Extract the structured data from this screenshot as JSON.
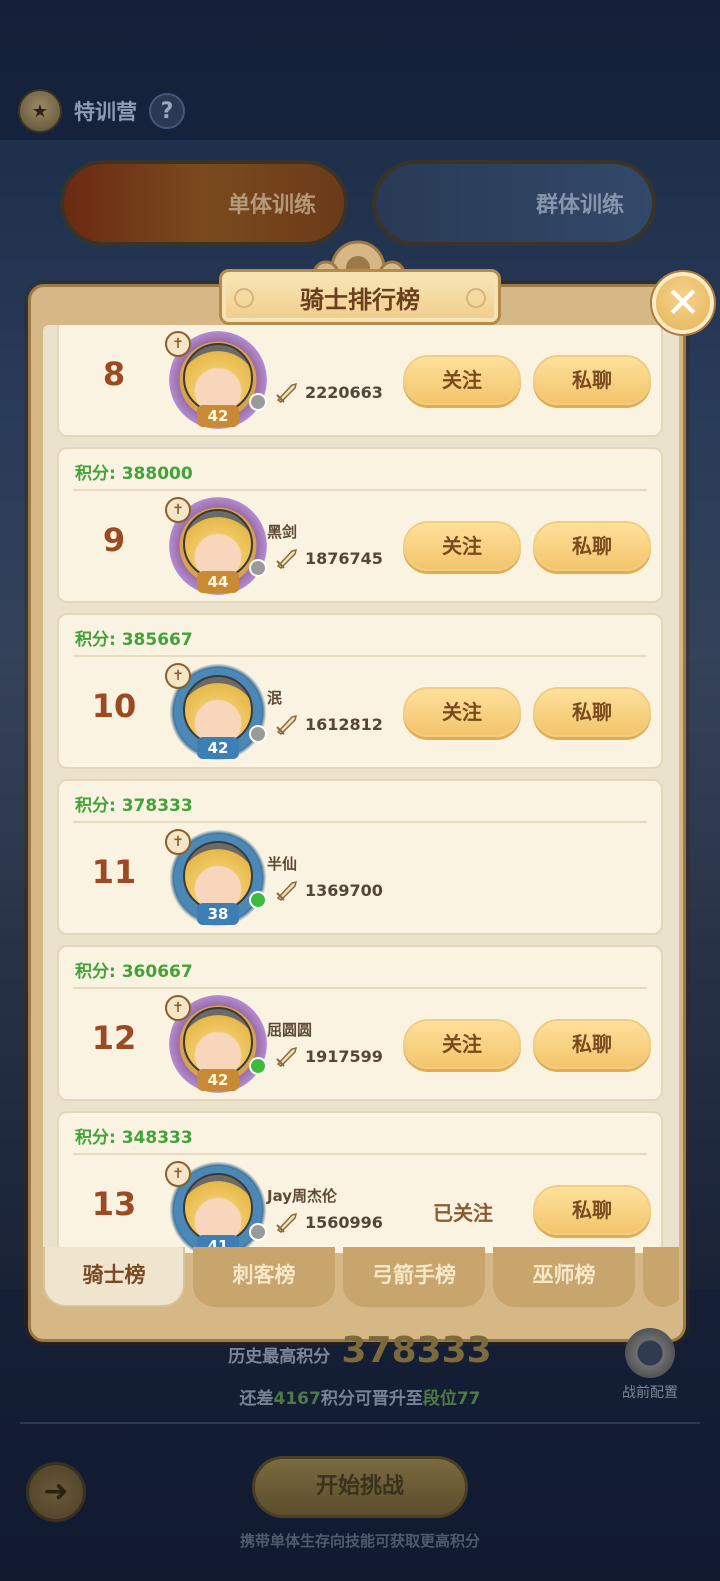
{
  "header": {
    "title": "特训营",
    "help": "?"
  },
  "modes": [
    {
      "label": "单体训练"
    },
    {
      "label": "群体训练"
    }
  ],
  "panel": {
    "title": "骑士排行榜"
  },
  "entries": [
    {
      "score_label": "",
      "rank": "8",
      "name": "",
      "power": "2220663",
      "level": "42",
      "frame": "gold",
      "status": "offline",
      "follow_label": "关注",
      "chat_label": "私聊",
      "followed": false,
      "partial": true
    },
    {
      "score_label": "积分: 388000",
      "rank": "9",
      "name": "黑剑",
      "power": "1876745",
      "level": "44",
      "frame": "gold",
      "status": "offline",
      "follow_label": "关注",
      "chat_label": "私聊",
      "followed": false
    },
    {
      "score_label": "积分: 385667",
      "rank": "10",
      "name": "泯",
      "power": "1612812",
      "level": "42",
      "frame": "blue",
      "status": "offline",
      "follow_label": "关注",
      "chat_label": "私聊",
      "followed": false
    },
    {
      "score_label": "积分: 378333",
      "rank": "11",
      "name": "半仙",
      "power": "1369700",
      "level": "38",
      "frame": "blue",
      "status": "online",
      "follow_label": "",
      "chat_label": "",
      "followed": false,
      "self": true
    },
    {
      "score_label": "积分: 360667",
      "rank": "12",
      "name": "屈圆圆",
      "power": "1917599",
      "level": "42",
      "frame": "gold",
      "status": "online",
      "follow_label": "关注",
      "chat_label": "私聊",
      "followed": false
    },
    {
      "score_label": "积分: 348333",
      "rank": "13",
      "name": "Jay周杰伦",
      "power": "1560996",
      "level": "41",
      "frame": "blue",
      "status": "offline",
      "follow_label": "已关注",
      "chat_label": "私聊",
      "followed": true
    }
  ],
  "tabs": [
    {
      "label": "骑士榜",
      "active": true
    },
    {
      "label": "刺客榜",
      "active": false
    },
    {
      "label": "弓箭手榜",
      "active": false
    },
    {
      "label": "巫师榜",
      "active": false
    }
  ],
  "footer": {
    "history_label": "历史最高积分",
    "history_value": "378333",
    "promo_prefix": "还差",
    "promo_points": "4167",
    "promo_middle": "积分可晋升至",
    "promo_rank": "段位77",
    "config_label": "战前配置",
    "start_label": "开始挑战",
    "hint": "携带单体生存向技能可获取更高积分"
  },
  "icons": {
    "close": "close-icon",
    "back": "back-arrow-icon",
    "cross": "cross-badge-icon",
    "sword": "sword-icon",
    "gear": "gear-icon"
  }
}
